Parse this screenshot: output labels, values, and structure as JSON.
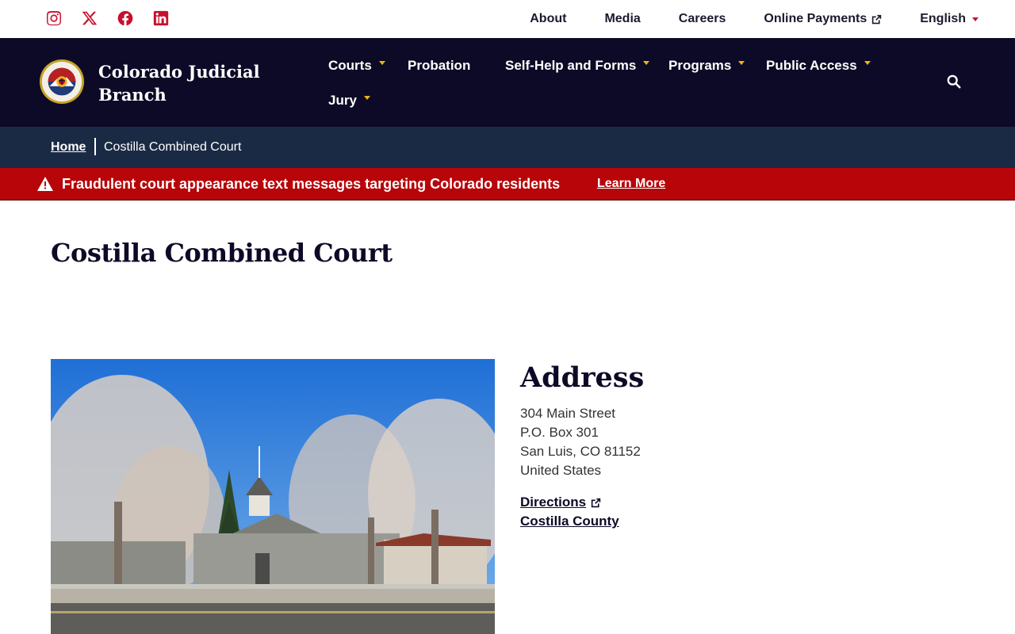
{
  "social": {
    "items": [
      {
        "name": "instagram-icon"
      },
      {
        "name": "x-icon"
      },
      {
        "name": "facebook-icon"
      },
      {
        "name": "linkedin-icon"
      }
    ],
    "color": "#c8102e"
  },
  "utility_nav": {
    "about": "About",
    "media": "Media",
    "careers": "Careers",
    "online_payments": "Online Payments",
    "language": "English"
  },
  "header": {
    "brand_line1": "Colorado Judicial",
    "brand_line2": "Branch",
    "bg_color": "#0c0a26",
    "accent_color": "#f2b21b"
  },
  "main_nav": {
    "courts": "Courts",
    "probation": "Probation",
    "self_help": "Self-Help and Forms",
    "programs": "Programs",
    "public_access": "Public Access",
    "jury": "Jury"
  },
  "breadcrumb": {
    "home": "Home",
    "current": "Costilla Combined Court"
  },
  "alert": {
    "message": "Fraudulent court appearance text messages targeting Colorado residents",
    "link": "Learn More",
    "bg_color": "#b70509"
  },
  "page": {
    "title": "Costilla Combined Court"
  },
  "address": {
    "heading": "Address",
    "line1": "304 Main Street",
    "line2": "P.O. Box 301",
    "line3": "San Luis, CO 81152",
    "line4": "United States",
    "directions": "Directions",
    "county": "Costilla County"
  }
}
